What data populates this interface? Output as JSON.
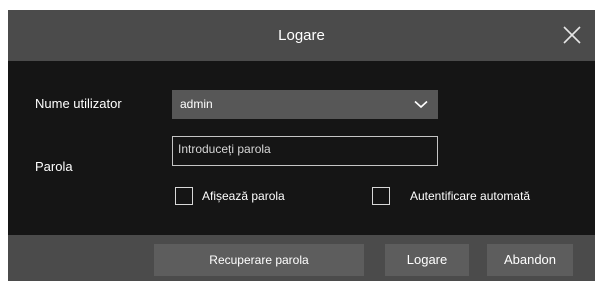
{
  "dialog": {
    "title": "Logare",
    "close_icon": "close-icon"
  },
  "form": {
    "username_label": "Nume utilizator",
    "username_value": "admin",
    "dropdown_icon": "chevron-down-icon",
    "password_label": "Parola",
    "password_placeholder": "Introduceți parola",
    "show_password_label": "Afișează parola",
    "show_password_checked": false,
    "auto_login_label": "Autentificare automată",
    "auto_login_checked": false
  },
  "footer": {
    "recover_label": "Recuperare parola",
    "login_label": "Logare",
    "cancel_label": "Abandon"
  },
  "colors": {
    "titlebar": "#4b4b4b",
    "body": "#151515",
    "button": "#5d5d5d",
    "select": "#575757",
    "text": "#ffffff"
  }
}
